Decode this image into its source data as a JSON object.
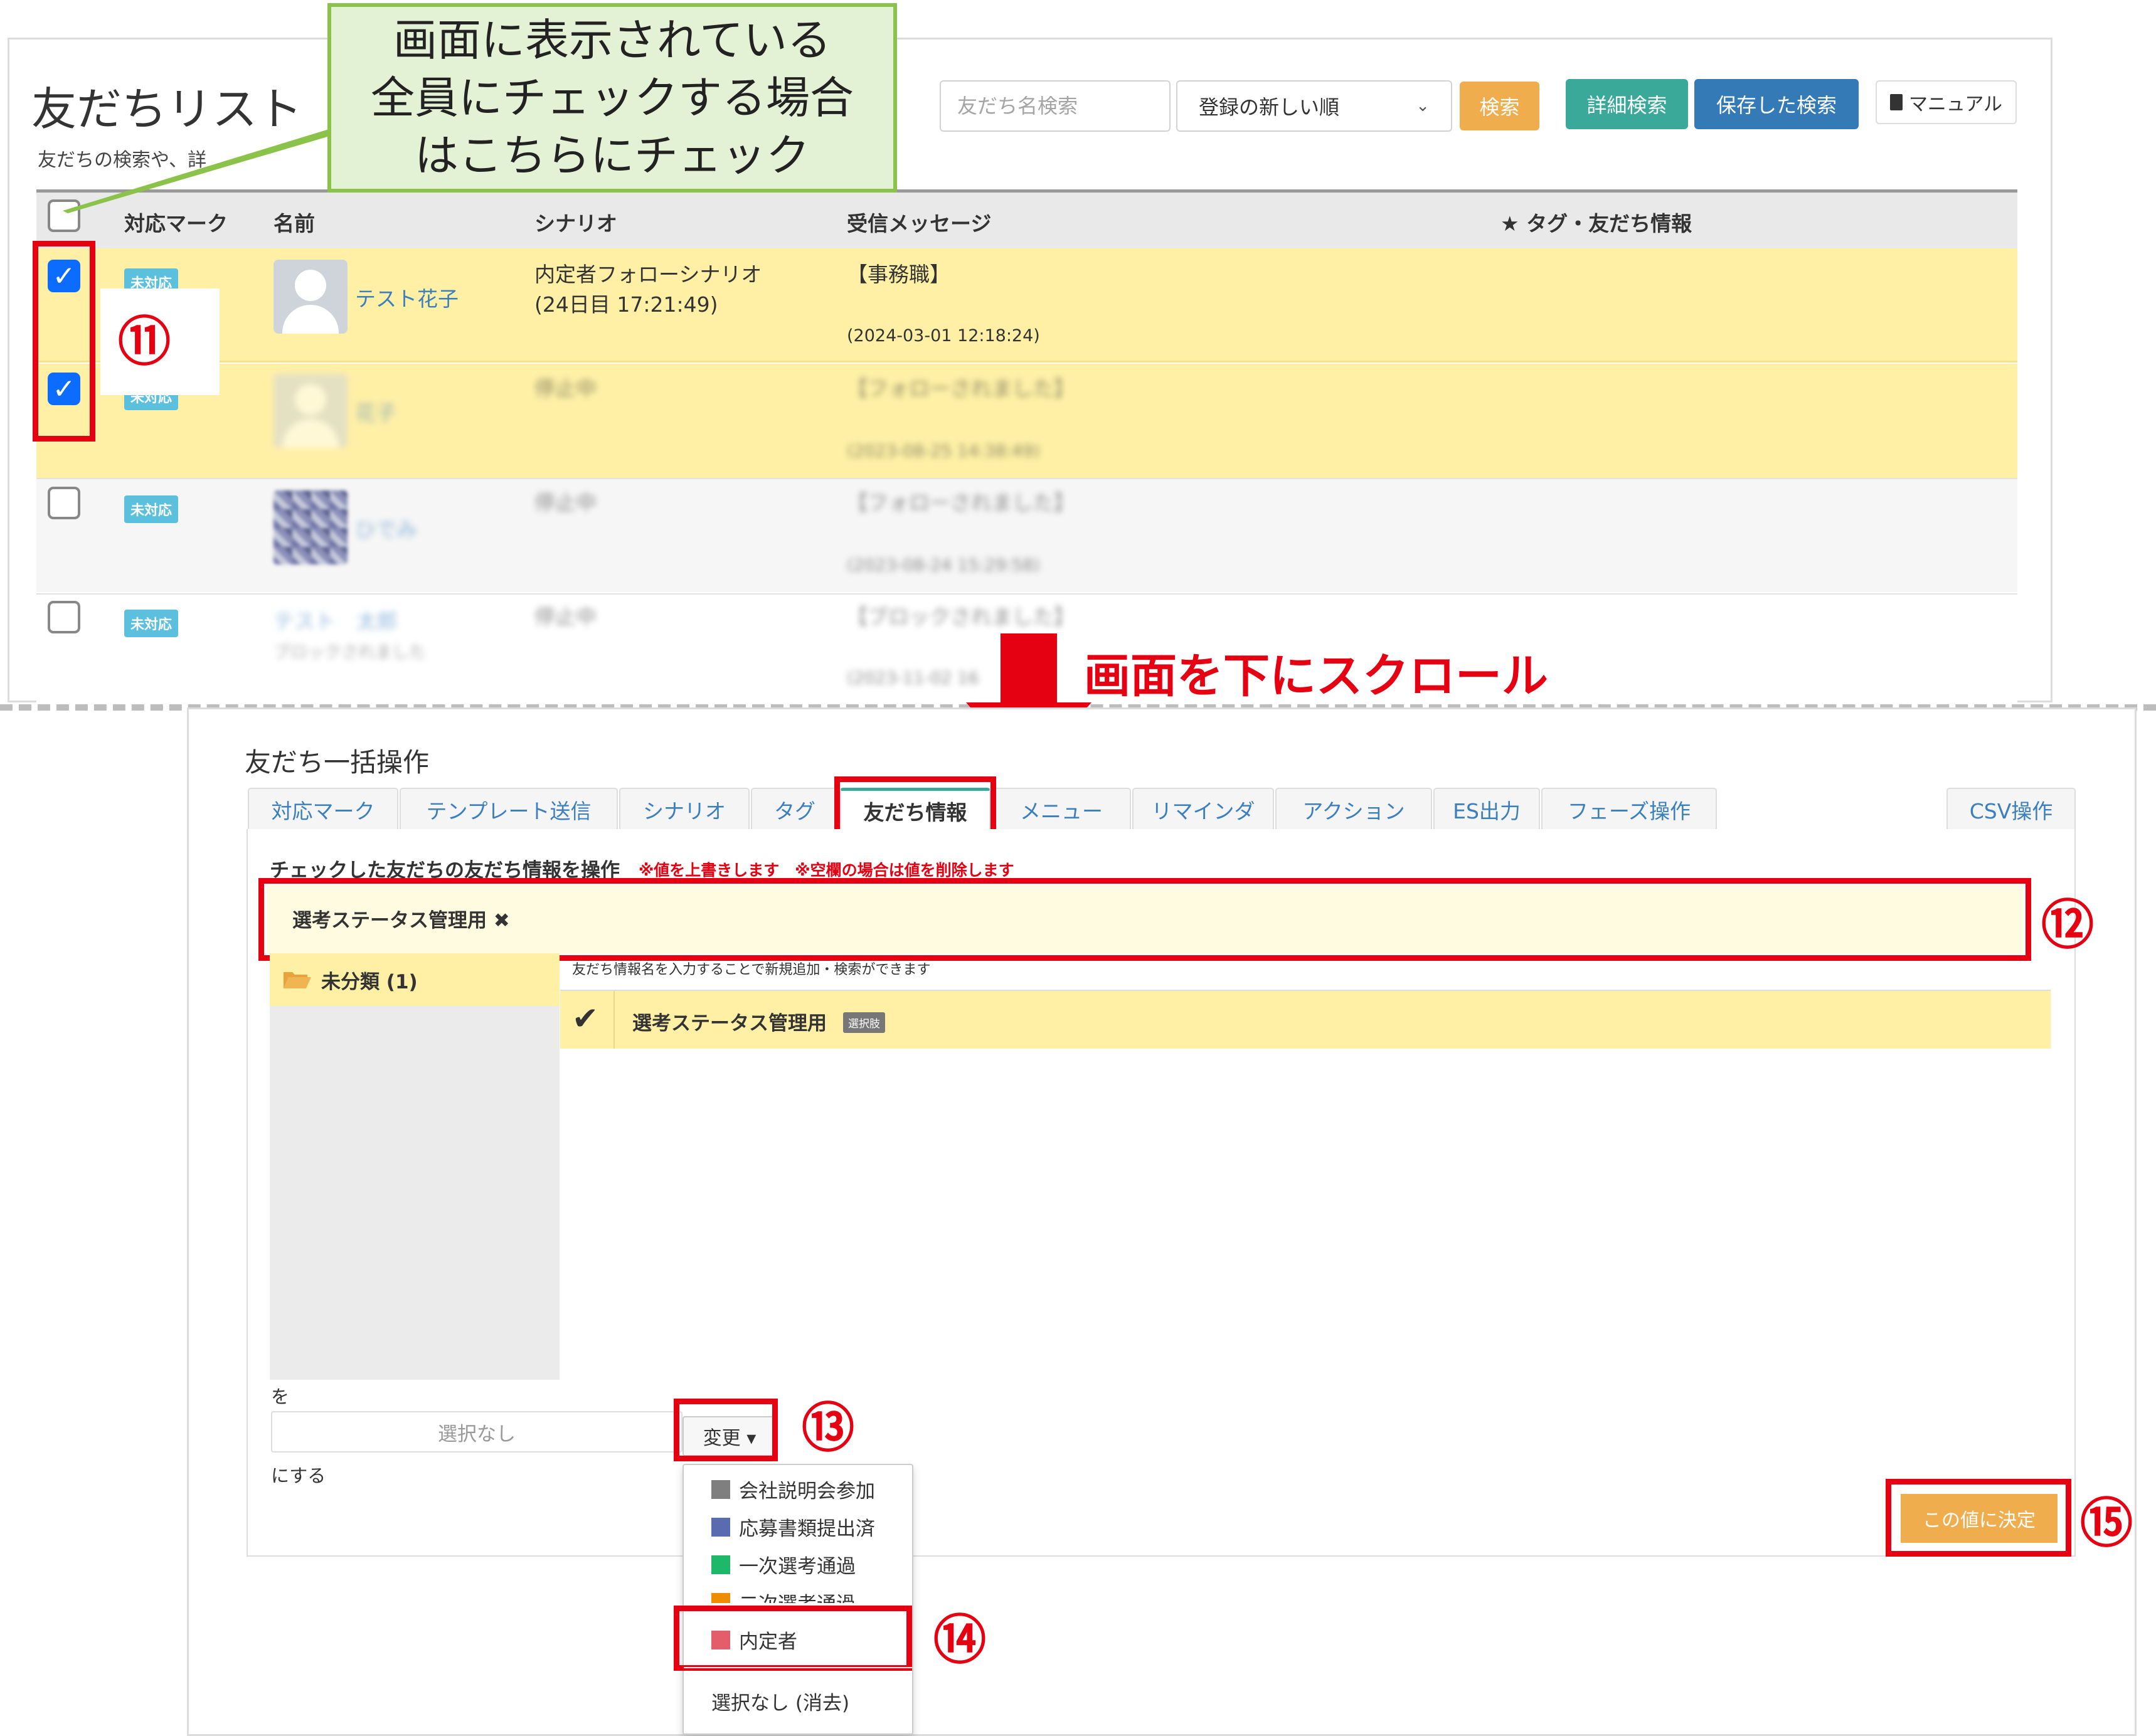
{
  "header": {
    "title": "友だちリスト",
    "subtitle": "友だちの検索や、詳"
  },
  "search": {
    "placeholder": "友だち名検索",
    "sort_value": "登録の新しい順",
    "search_label": "検索",
    "detail_label": "詳細検索",
    "saved_label": "保存した検索",
    "manual_label": "マニュアル"
  },
  "table": {
    "columns": [
      "対応マーク",
      "名前",
      "シナリオ",
      "受信メッセージ",
      "★ タグ・友だち情報"
    ],
    "rows": [
      {
        "checked": true,
        "mark": "未対応",
        "name": "テスト花子",
        "scenario": "内定者フォローシナリオ",
        "scenario_sub": "(24日目 17:21:49)",
        "message": "【事務職】",
        "date": "(2024-03-01 12:18:24)"
      },
      {
        "checked": true,
        "mark": "未対応",
        "name": "花子",
        "scenario": "停止中",
        "scenario_sub": "",
        "message": "【フォローされました】",
        "date": "(2023-08-25 14:38:49)"
      },
      {
        "checked": false,
        "mark": "未対応",
        "name": "ひでみ",
        "scenario": "停止中",
        "scenario_sub": "",
        "message": "【フォローされました】",
        "date": "(2023-08-24 15:29:58)"
      },
      {
        "checked": false,
        "mark": "未対応",
        "name": "テスト　太郎",
        "name_sub": "ブロックされました",
        "scenario": "停止中",
        "scenario_sub": "",
        "message": "【ブロックされました】",
        "date": "(2023-11-02 16"
      }
    ]
  },
  "annotations": {
    "callout": [
      "画面に表示されている",
      "全員にチェックする場合",
      "はこちらにチェック"
    ],
    "scroll": "画面を下にスクロール",
    "n11": "⑪",
    "n12": "⑫",
    "n13": "⑬",
    "n14": "⑭",
    "n15": "⑮",
    "accent_color": "#e50012"
  },
  "bulk": {
    "title": "友だち一括操作",
    "tabs": [
      "対応マーク",
      "テンプレート送信",
      "シナリオ",
      "タグ",
      "友だち情報",
      "メニュー",
      "リマインダ",
      "アクション",
      "ES出力",
      "フェーズ操作",
      "CSV操作"
    ],
    "active_tab": "友だち情報",
    "op_title": "チェックした友だちの友だち情報を操作",
    "op_note": "※値を上書きします　※空欄の場合は値を削除します",
    "selected_tag": "選考ステータス管理用 ✖",
    "tree_item": "未分類 (1)",
    "right_note": "友だち情報名を入力することで新規追加・検索ができます",
    "right_item": "選考ステータス管理用",
    "right_item_badge": "選択肢",
    "wo": "を",
    "value_placeholder": "選択なし",
    "change_label": "変更 ▾",
    "nisuru": "にする",
    "dropdown": [
      {
        "label": "会社説明会参加",
        "color": "#7f7f7f"
      },
      {
        "label": "応募書類提出済",
        "color": "#5b6bb0"
      },
      {
        "label": "一次選考通過",
        "color": "#1db86a"
      },
      {
        "label": "二次選考通過",
        "color": "#f08c00"
      },
      {
        "label": "内定者",
        "color": "#e35d6a"
      }
    ],
    "dropdown_clear": "選択なし (消去)",
    "decide_label": "この値に決定"
  }
}
